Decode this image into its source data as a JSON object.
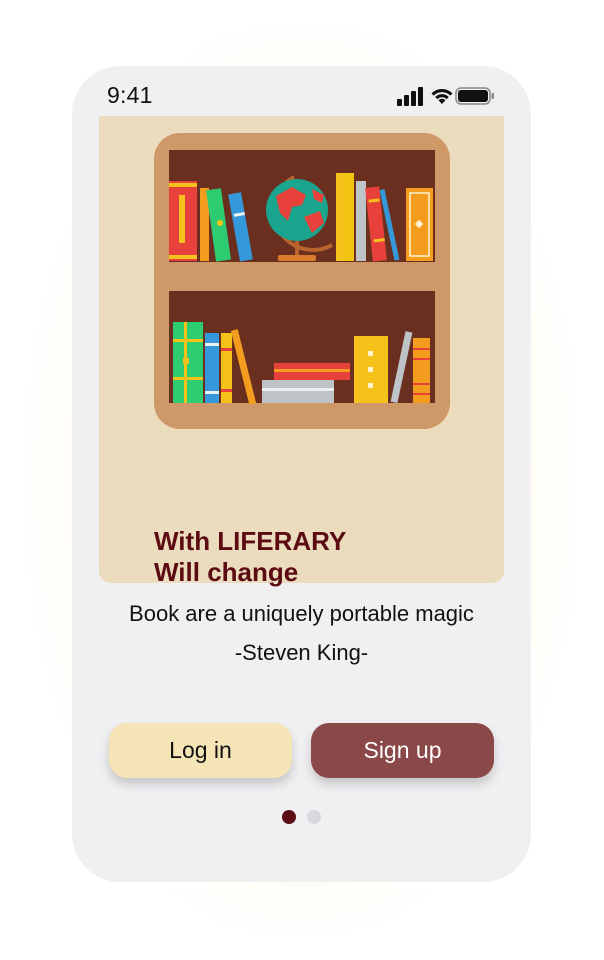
{
  "status_bar": {
    "time": "9:41",
    "icons": [
      "signal-icon",
      "wifi-icon",
      "battery-icon"
    ]
  },
  "hero": {
    "illustration": "bookshelf-with-globe",
    "title_line1": "With LIFERARY",
    "title_line2": "Will change"
  },
  "quote": {
    "text": "Book are a uniquely portable magic",
    "author": "-Steven King-"
  },
  "actions": {
    "login_label": "Log in",
    "signup_label": "Sign up"
  },
  "pagination": {
    "total": 2,
    "active": 1
  },
  "colors": {
    "accent_dark": "#5c0b12",
    "signup_bg": "#8b4848",
    "login_bg": "#f4e4b6",
    "hero_bg": "#eadcbd",
    "phone_bg": "#f0eff2"
  }
}
